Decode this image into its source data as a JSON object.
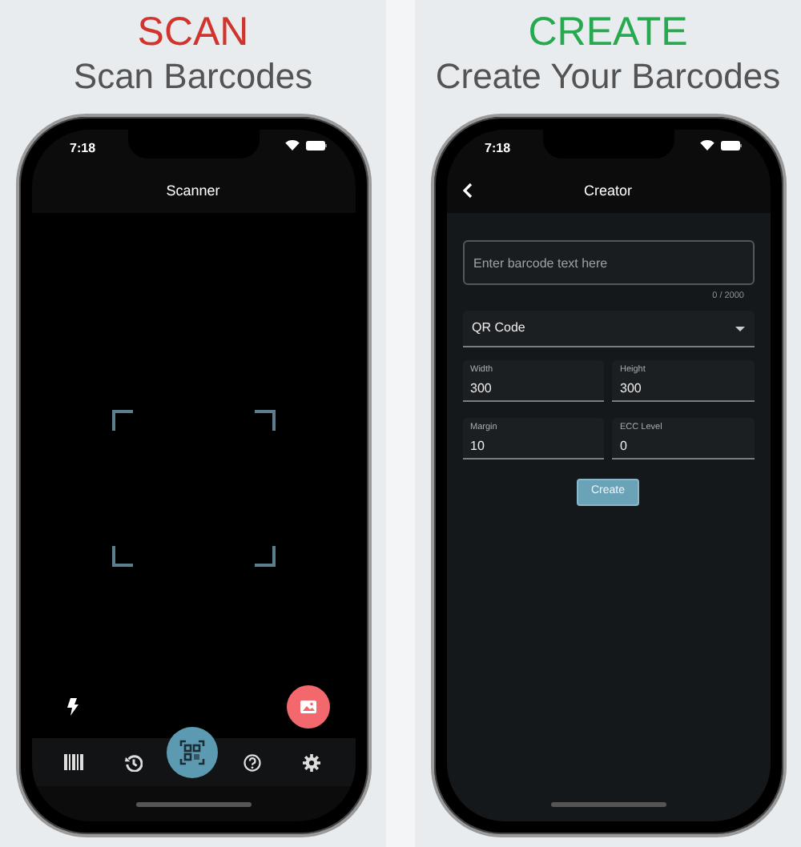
{
  "panels": [
    {
      "kind": "scan",
      "heading": "SCAN",
      "color": "#d0342c",
      "subheading": "Scan Barcodes",
      "phone": {
        "time": "7:18",
        "title": "Scanner",
        "nav": [
          {
            "selected": false
          },
          {
            "selected": false
          },
          {
            "selected": true
          },
          {
            "selected": false
          },
          {
            "selected": false
          }
        ]
      }
    },
    {
      "kind": "create",
      "heading": "CREATE",
      "color": "#27a94f",
      "subheading": "Create Your Barcodes",
      "phone": {
        "time": "7:18",
        "title": "Creator",
        "text_field": {
          "placeholder": "Enter barcode text here",
          "counter": "0 / 2000"
        },
        "dropdown": {
          "value": "QR Code"
        },
        "fields": [
          {
            "label": "Width",
            "value": "300"
          },
          {
            "label": "Height",
            "value": "300"
          },
          {
            "label": "Margin",
            "value": "10"
          },
          {
            "label": "ECC Level",
            "value": "0"
          }
        ],
        "button": "Create"
      }
    }
  ]
}
